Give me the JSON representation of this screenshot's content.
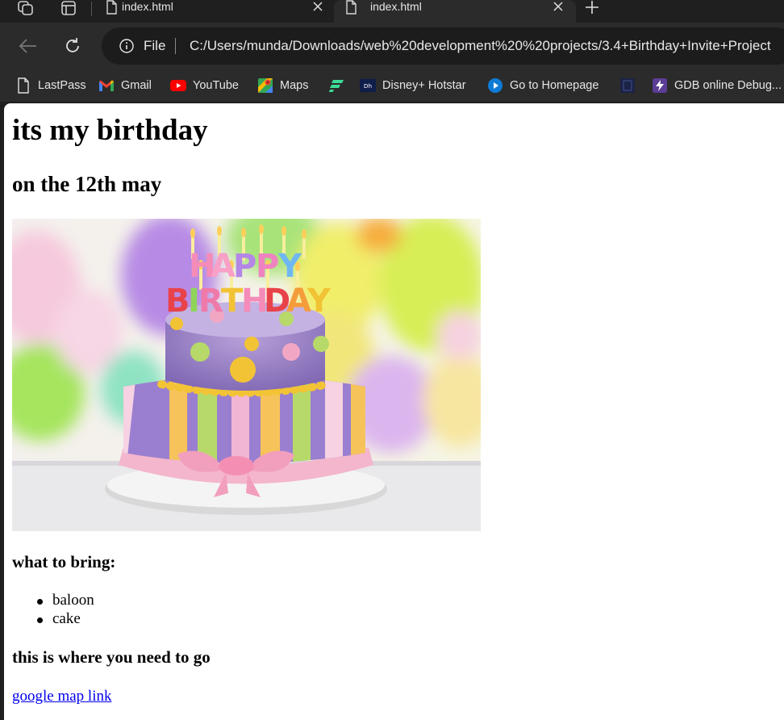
{
  "browser": {
    "tabs": [
      {
        "title": "index.html",
        "active": false
      },
      {
        "title": "index.html",
        "active": true
      }
    ],
    "address": {
      "scheme_label": "File",
      "url": "C:/Users/munda/Downloads/web%20development%20%20projects/3.4+Birthday+Invite+Project"
    },
    "bookmarks": [
      {
        "label": "LastPass",
        "icon": "document-icon"
      },
      {
        "label": "Gmail",
        "icon": "gmail-icon"
      },
      {
        "label": "YouTube",
        "icon": "youtube-icon"
      },
      {
        "label": "Maps",
        "icon": "maps-icon"
      },
      {
        "label": "",
        "icon": "stripes-icon"
      },
      {
        "label": "Disney+ Hotstar",
        "icon": "hotstar-icon"
      },
      {
        "label": "Go to Homepage",
        "icon": "play-circle-icon"
      },
      {
        "label": "",
        "icon": "bookmark-icon"
      },
      {
        "label": "GDB online Debug...",
        "icon": "lightning-icon"
      }
    ]
  },
  "page": {
    "heading": "its my birthday",
    "subheading": "on the 12th may",
    "image_text": "HAPPY BIRTHDAY",
    "bring_heading": "what to bring:",
    "bring_items": [
      "baloon",
      "cake"
    ],
    "where_heading": "this is where you need to go",
    "map_link": "google map link"
  }
}
